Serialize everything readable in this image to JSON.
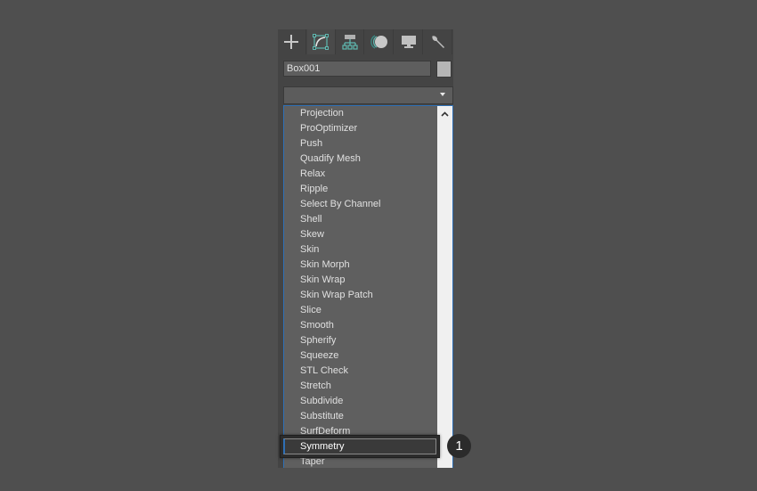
{
  "command_panel": {
    "tabs": [
      {
        "name": "create",
        "icon": "plus-icon"
      },
      {
        "name": "modify",
        "icon": "modify-curve-icon",
        "active": true
      },
      {
        "name": "hierarchy",
        "icon": "hierarchy-icon"
      },
      {
        "name": "motion",
        "icon": "motion-icon"
      },
      {
        "name": "display",
        "icon": "display-monitor-icon"
      },
      {
        "name": "utilities",
        "icon": "wrench-icon"
      }
    ],
    "object_name": "Box001",
    "object_color": "#b5b5b5",
    "modifier_list_value": "",
    "modifier_list_items": [
      "Projection",
      "ProOptimizer",
      "Push",
      "Quadify Mesh",
      "Relax",
      "Ripple",
      "Select By Channel",
      "Shell",
      "Skew",
      "Skin",
      "Skin Morph",
      "Skin Wrap",
      "Skin Wrap Patch",
      "Slice",
      "Smooth",
      "Spherify",
      "Squeeze",
      "STL Check",
      "Stretch",
      "Subdivide",
      "Substitute",
      "SurfDeform",
      "Symmetry",
      "Taper"
    ]
  },
  "callout": {
    "highlighted_item": "Symmetry",
    "step_number": "1"
  },
  "colors": {
    "accent": "#2e6fb5",
    "modify_icon": "#5fb8b0",
    "background": "#4f4f4f"
  }
}
